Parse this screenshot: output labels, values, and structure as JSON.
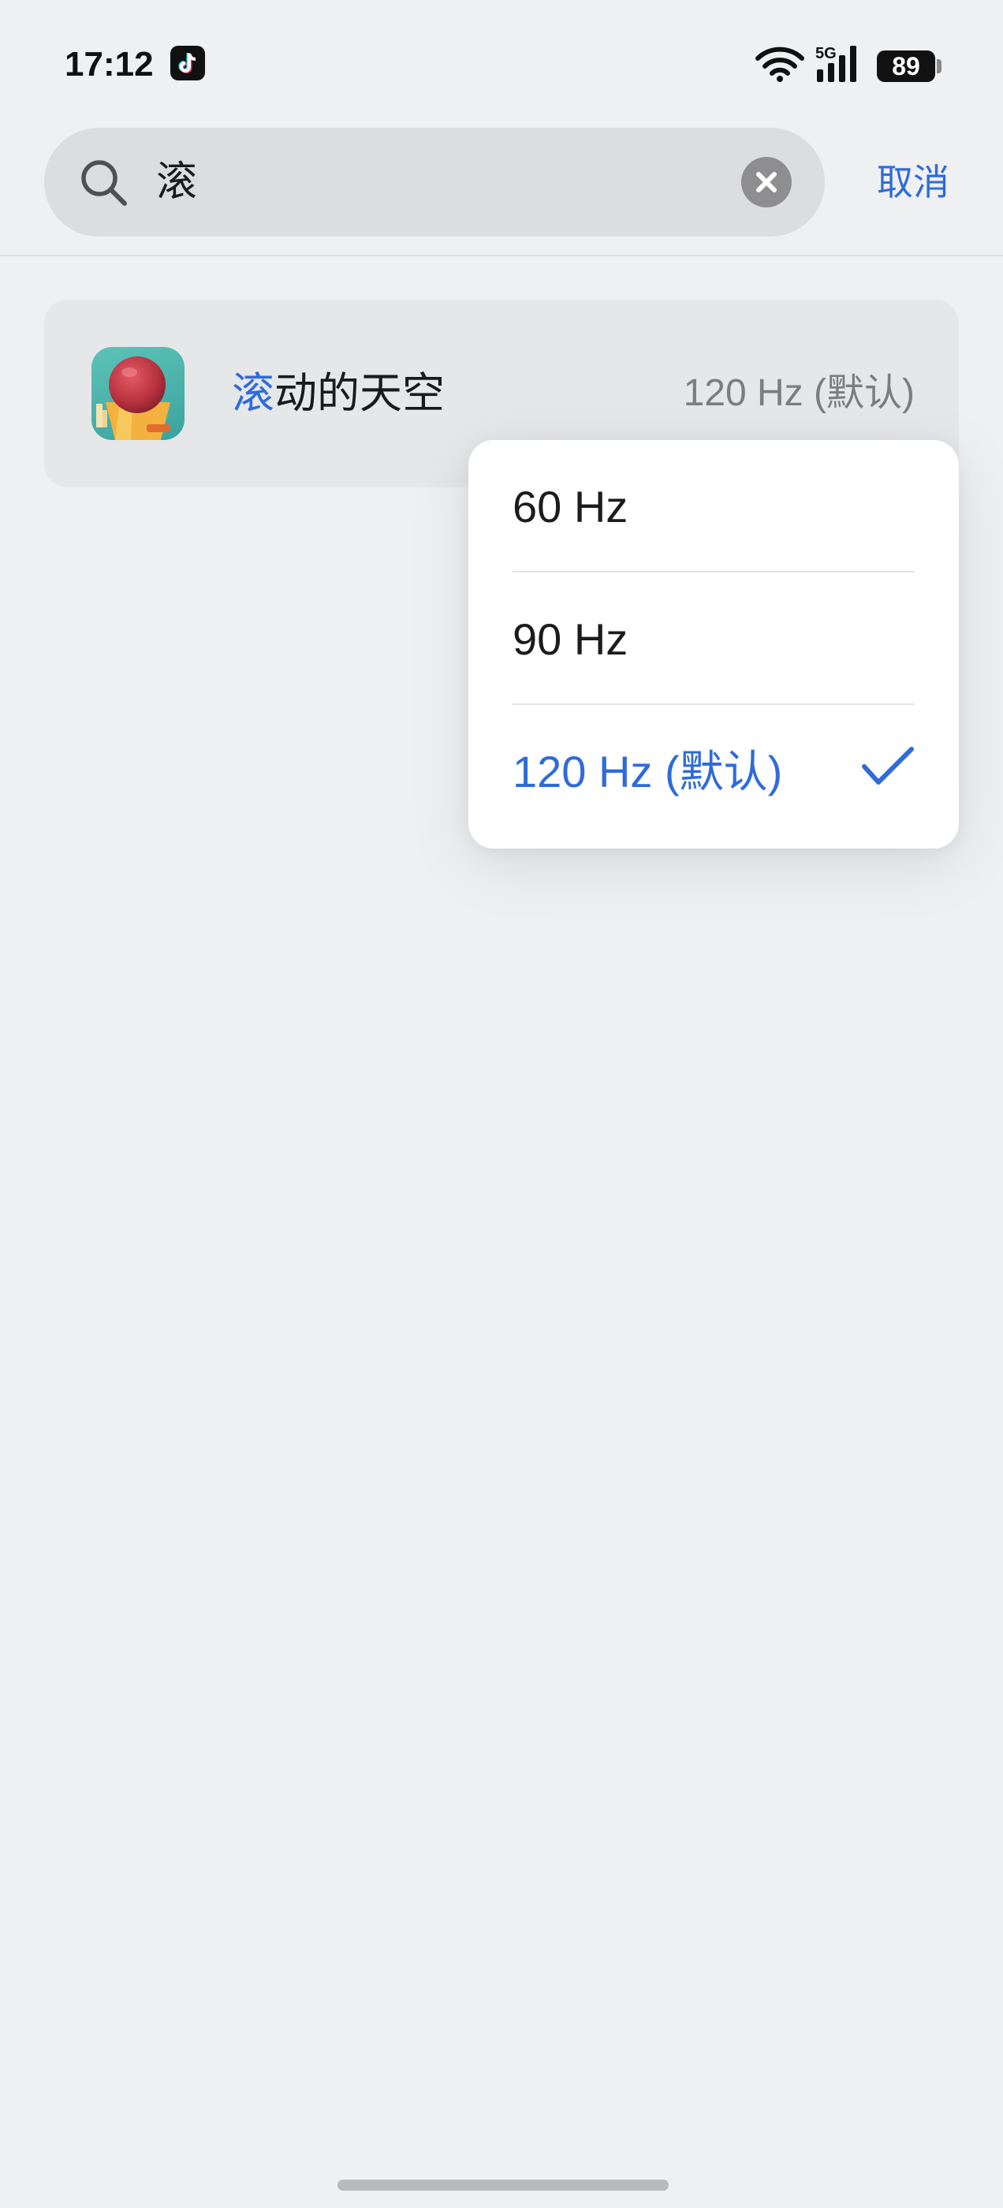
{
  "status_bar": {
    "time": "17:12",
    "notification_icon": "tiktok-icon",
    "network_label": "5G",
    "battery": "89"
  },
  "search": {
    "query": "滚",
    "cancel_label": "取消"
  },
  "result": {
    "app_name_highlight": "滚",
    "app_name_rest": "动的天空",
    "refresh_rate": "120 Hz (默认)"
  },
  "dropdown": {
    "options": [
      {
        "label": "60 Hz",
        "selected": false
      },
      {
        "label": "90 Hz",
        "selected": false
      },
      {
        "label": "120 Hz (默认)",
        "selected": true
      }
    ]
  },
  "colors": {
    "accent": "#2f6bd9",
    "background": "#eff0f2",
    "card": "#e6e7e9"
  }
}
